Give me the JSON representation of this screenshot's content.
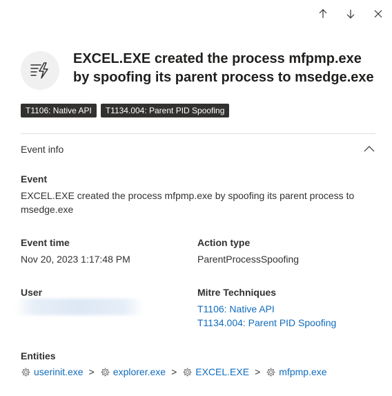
{
  "title": "EXCEL.EXE created the process mfpmp.exe by spoofing its parent process to msedge.exe",
  "tags": [
    {
      "label": "T1106: Native API"
    },
    {
      "label": "T1134.004: Parent PID Spoofing"
    }
  ],
  "section": {
    "title": "Event info"
  },
  "event": {
    "label": "Event",
    "value": "EXCEL.EXE created the process mfpmp.exe by spoofing its parent process to msedge.exe"
  },
  "event_time": {
    "label": "Event time",
    "value": "Nov 20, 2023 1:17:48 PM"
  },
  "action_type": {
    "label": "Action type",
    "value": "ParentProcessSpoofing"
  },
  "user": {
    "label": "User"
  },
  "mitre": {
    "label": "Mitre Techniques",
    "items": [
      "T1106: Native API",
      "T1134.004: Parent PID Spoofing"
    ]
  },
  "entities": {
    "label": "Entities",
    "separator": ">",
    "items": [
      "userinit.exe",
      "explorer.exe",
      "EXCEL.EXE",
      "mfpmp.exe"
    ]
  },
  "colors": {
    "link": "#0f6cbd",
    "tag_bg": "#323130",
    "avatar_bg": "#f0f0f0"
  },
  "icons": {
    "nav": [
      "arrow-up-icon",
      "arrow-down-icon",
      "close-icon"
    ],
    "avatar": "process-lightning-icon",
    "entity": "gear-icon",
    "section": "chevron-up-icon"
  }
}
